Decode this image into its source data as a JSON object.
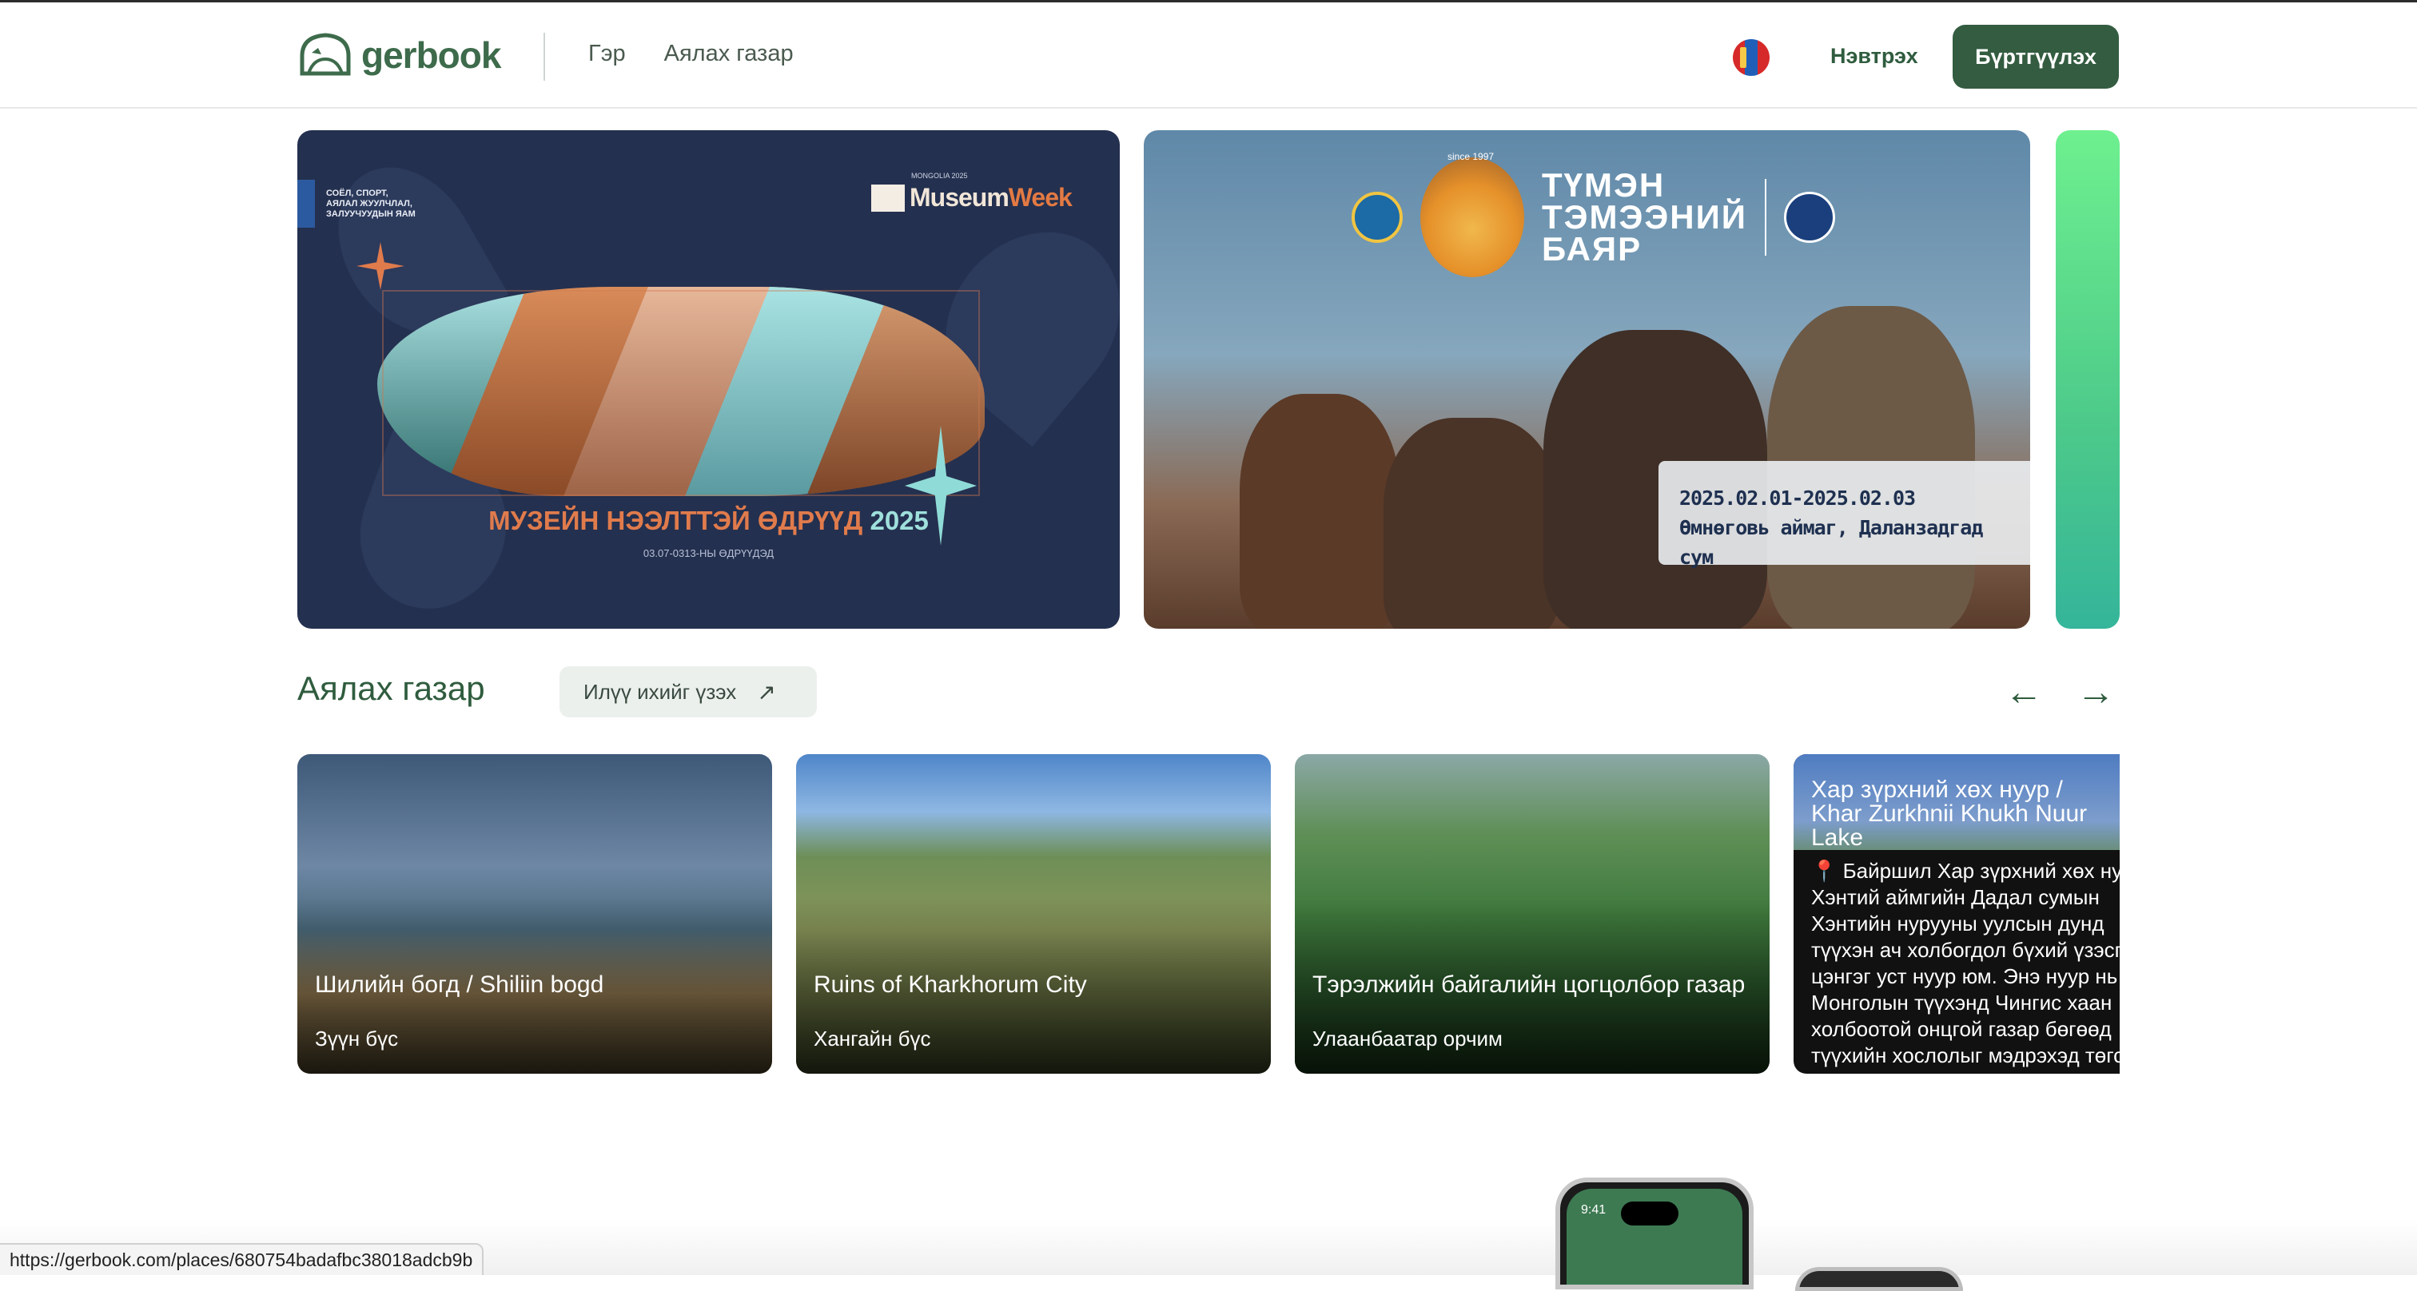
{
  "header": {
    "logo_text": "gerbook",
    "nav": [
      "Гэр",
      "Аялах газар"
    ],
    "login_label": "Нэвтрэх",
    "register_label": "Бүртгүүлэх",
    "flag": "mongolia-flag"
  },
  "banners": [
    {
      "ministry_text": "СОЁЛ, СПОРТ, АЯЛАЛ ЖУУЛЧЛАЛ, ЗАЛУУЧУУДЫН ЯАМ",
      "brand_small": "MONGOLIA 2025",
      "brand_a": "Museum",
      "brand_b": "Week",
      "title_a": "МУЗЕЙН НЭЭЛТТЭЙ ӨДРҮҮД",
      "title_b": "2025",
      "subtitle": "03.07-0313-НЫ ӨДРҮҮДЭД"
    },
    {
      "since": "since 1997",
      "title_line1": "ТҮМЭН",
      "title_line2": "ТЭМЭЭНИЙ",
      "title_line3": "БАЯР",
      "date_range": "2025.02.01-2025.02.03",
      "location": "Өмнөговь аймаг, Даланзадгад сум"
    }
  ],
  "section": {
    "title": "Аялах газар",
    "see_all_label": "Илүү ихийг үзэх",
    "see_all_icon": "arrow-up-right-icon",
    "prev_icon": "arrow-left-icon",
    "next_icon": "arrow-right-icon"
  },
  "places": [
    {
      "title": "Шилийн богд / Shiliin bogd",
      "subtitle": "Зүүн бүс"
    },
    {
      "title": "Ruins of Kharkhorum City",
      "subtitle": "Хангайн бүс"
    },
    {
      "title": "Тэрэлжийн байгалийн цогцолбор газар",
      "subtitle": "Улаанбаатар орчим"
    },
    {
      "title": "Хар зүрхний хөх нуур / Khar Zurkhnii Khukh Nuur Lake",
      "lines": [
        "📍 Байршил Хар зүрхний хөх нуур",
        "Хэнтий аймгийн Дадал сумын",
        "Хэнтийн нурууны уулсын дунд",
        "түүхэн ач холбогдол бүхий үзэсгэлэнт",
        "цэнгэг уст нуур юм. Энэ нуур нь",
        "Монголын түүхэнд Чингис хаан",
        "холбоотой онцгой газар бөгөөд",
        "түүхийн хослолыг мэдрэхэд төгс"
      ]
    }
  ],
  "status_url": "https://gerbook.com/places/680754badafbc38018adcb9b",
  "phone_time": "9:41"
}
